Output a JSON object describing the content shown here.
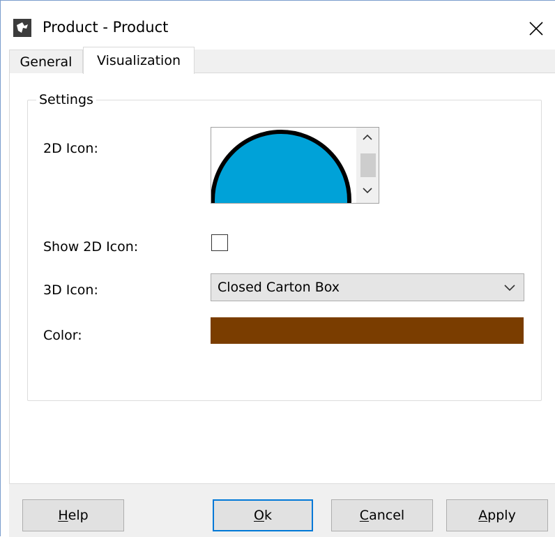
{
  "window": {
    "title": "Product - Product",
    "app_icon": "app-logo-icon",
    "close_icon": "close-icon"
  },
  "tabs": [
    {
      "label": "General",
      "selected": false
    },
    {
      "label": "Visualization",
      "selected": true
    }
  ],
  "settings": {
    "group_label": "Settings",
    "icon_2d": {
      "label": "2D Icon:",
      "preview_icon": "blue-circle-icon",
      "fill_color": "#00a2d8",
      "outline_color": "#000000"
    },
    "show_2d_icon": {
      "label": "Show 2D Icon:",
      "checked": false
    },
    "icon_3d": {
      "label": "3D Icon:",
      "value": "Closed Carton Box"
    },
    "color": {
      "label": "Color:",
      "value": "#7a3d00"
    }
  },
  "buttons": {
    "help": {
      "accel": "H",
      "rest": "elp"
    },
    "ok": {
      "accel": "O",
      "rest": "k"
    },
    "cancel": {
      "accel": "C",
      "rest": "ancel"
    },
    "apply": {
      "accel": "A",
      "rest": "pply"
    }
  },
  "colors": {
    "accent": "#0078d7",
    "button_face": "#e1e1e1",
    "panel": "#f0f0f0"
  }
}
